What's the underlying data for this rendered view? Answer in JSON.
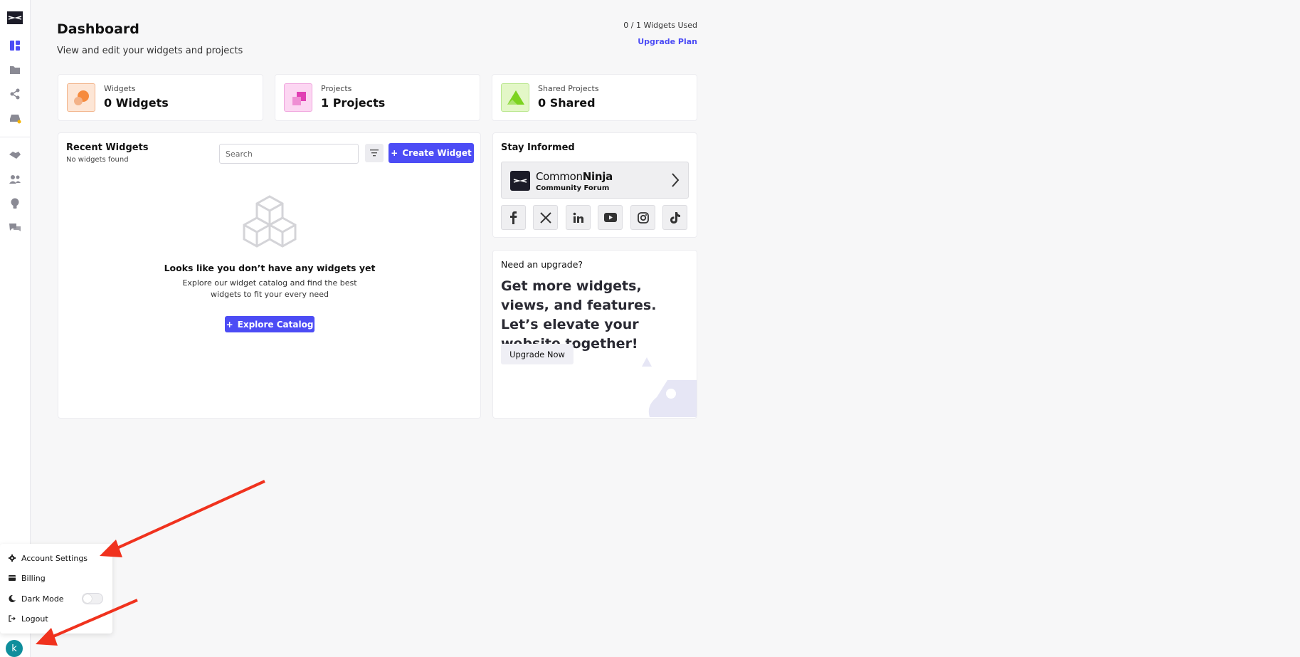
{
  "header": {
    "title": "Dashboard",
    "subtitle": "View and edit your widgets and projects",
    "usage": "0 / 1 Widgets Used",
    "upgrade_plan": "Upgrade Plan"
  },
  "stats": [
    {
      "label": "Widgets",
      "value": "0 Widgets"
    },
    {
      "label": "Projects",
      "value": "1 Projects"
    },
    {
      "label": "Shared Projects",
      "value": "0 Shared"
    }
  ],
  "recent_widgets": {
    "title": "Recent Widgets",
    "subtitle": "No widgets found",
    "search_placeholder": "Search",
    "create_button": "Create Widget",
    "empty_title": "Looks like you don’t have any widgets yet",
    "empty_text": "Explore our widget catalog and find the best widgets to fit your every need",
    "explore_button": "Explore Catalog"
  },
  "stay_informed": {
    "title": "Stay Informed",
    "forum_brand_light": "Common",
    "forum_brand_bold": "Ninja",
    "forum_sub": "Community Forum",
    "socials": [
      "facebook-icon",
      "x-icon",
      "linkedin-icon",
      "youtube-icon",
      "instagram-icon",
      "tiktok-icon"
    ]
  },
  "upgrade": {
    "label": "Need an upgrade?",
    "headline": "Get more widgets, views, and features. Let’s elevate your website together!",
    "button": "Upgrade Now"
  },
  "menu": {
    "account_settings": "Account Settings",
    "billing": "Billing",
    "dark_mode": "Dark Mode",
    "dark_mode_on": false,
    "logout": "Logout"
  },
  "user": {
    "avatar_letter": "k"
  },
  "colors": {
    "accent": "#4c4cf5",
    "avatar": "#0f8e9c",
    "arrow": "#f0321e"
  }
}
